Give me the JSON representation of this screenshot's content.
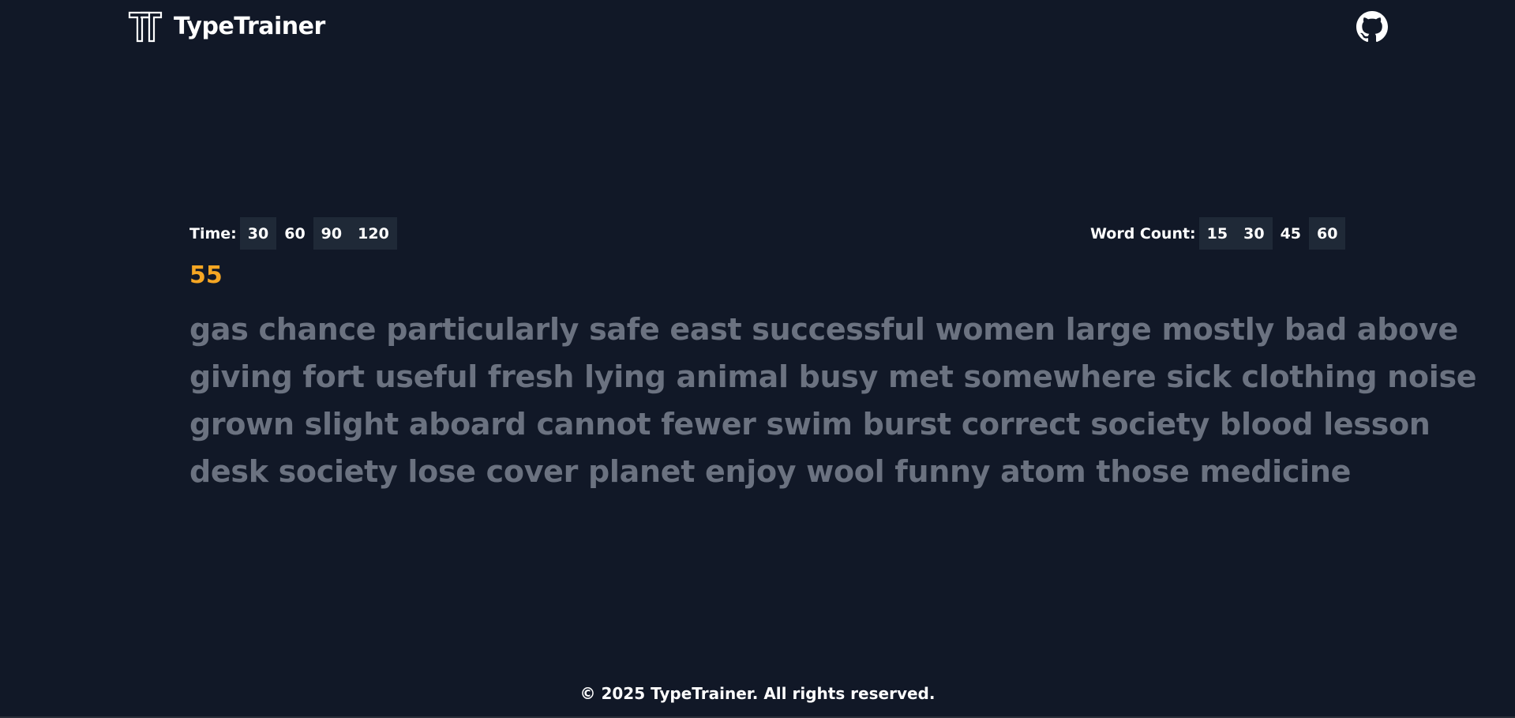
{
  "header": {
    "brand_name": "TypeTrainer",
    "logo_icon": "tt-logo-icon",
    "github_icon": "github-icon"
  },
  "options": {
    "time": {
      "label": "Time:",
      "values": [
        "30",
        "60",
        "90",
        "120"
      ]
    },
    "word_count": {
      "label": "Word Count:",
      "values": [
        "15",
        "30",
        "45",
        "60"
      ]
    }
  },
  "countdown": "55",
  "words_lines": [
    "gas chance particularly safe east successful women large mostly bad above",
    "giving fort useful fresh lying animal busy met somewhere sick clothing noise",
    "grown slight aboard cannot fewer swim burst correct society blood lesson",
    "desk society lose cover planet enjoy wool funny atom those medicine"
  ],
  "footer": {
    "text": "© 2025 TypeTrainer. All rights reserved."
  },
  "colors": {
    "background": "#111827",
    "option_highlight": "#1f2937",
    "countdown": "#f5a623",
    "untyped_text": "#6b7280"
  }
}
